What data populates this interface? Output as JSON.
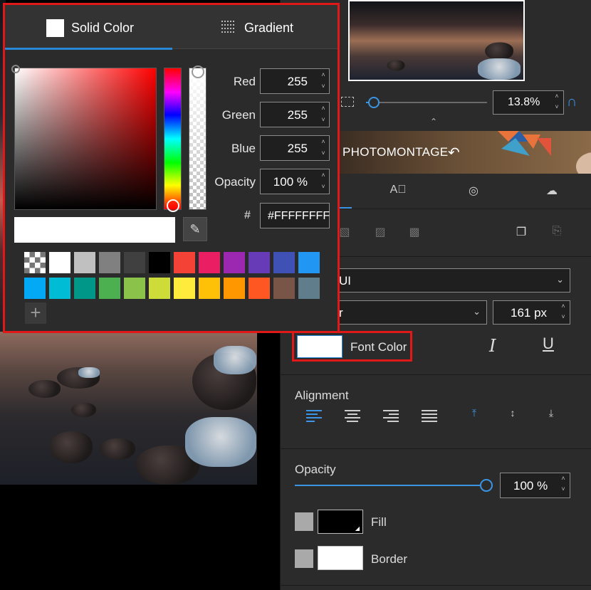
{
  "picker": {
    "tabs": [
      {
        "label": "Solid Color"
      },
      {
        "label": "Gradient"
      }
    ],
    "fields": {
      "red": {
        "label": "Red",
        "value": "255"
      },
      "green": {
        "label": "Green",
        "value": "255"
      },
      "blue": {
        "label": "Blue",
        "value": "255"
      },
      "opacity": {
        "label": "Opacity",
        "value": "100 %"
      }
    },
    "hex_prefix": "#",
    "hex_value": "#FFFFFFFF",
    "current_color": "#FFFFFF",
    "swatches_row1": [
      "transparent",
      "#FFFFFF",
      "#C0C0C0",
      "#808080",
      "#404040",
      "#000000",
      "#F44336",
      "#E91E63",
      "#9C27B0",
      "#673AB7",
      "#3F51B5",
      "#2196F3"
    ],
    "swatches_row2": [
      "#03A9F4",
      "#00BCD4",
      "#009688",
      "#4CAF50",
      "#8BC34A",
      "#CDDC39",
      "#FFEB3B",
      "#FFC107",
      "#FF9800",
      "#FF5722",
      "#795548",
      "#607D8B"
    ]
  },
  "navigator": {
    "zoom_value": "13.8%",
    "zoom_fraction": 0.03
  },
  "banner": {
    "title": "PHOTOMONTAGE"
  },
  "text_props": {
    "font_family": "UI",
    "font_style": "r",
    "font_size": "161 px",
    "font_color_label": "Font Color",
    "font_color": "#FFFFFF",
    "italic_label": "I",
    "underline_label": "U"
  },
  "alignment": {
    "label": "Alignment"
  },
  "opacity": {
    "label": "Opacity",
    "value": "100 %",
    "fraction": 1.0
  },
  "fill": {
    "label": "Fill",
    "color": "#000000"
  },
  "border": {
    "label": "Border",
    "color": "#FFFFFF"
  },
  "accent_color": "#2A87D6",
  "highlight_color": "#E01818"
}
